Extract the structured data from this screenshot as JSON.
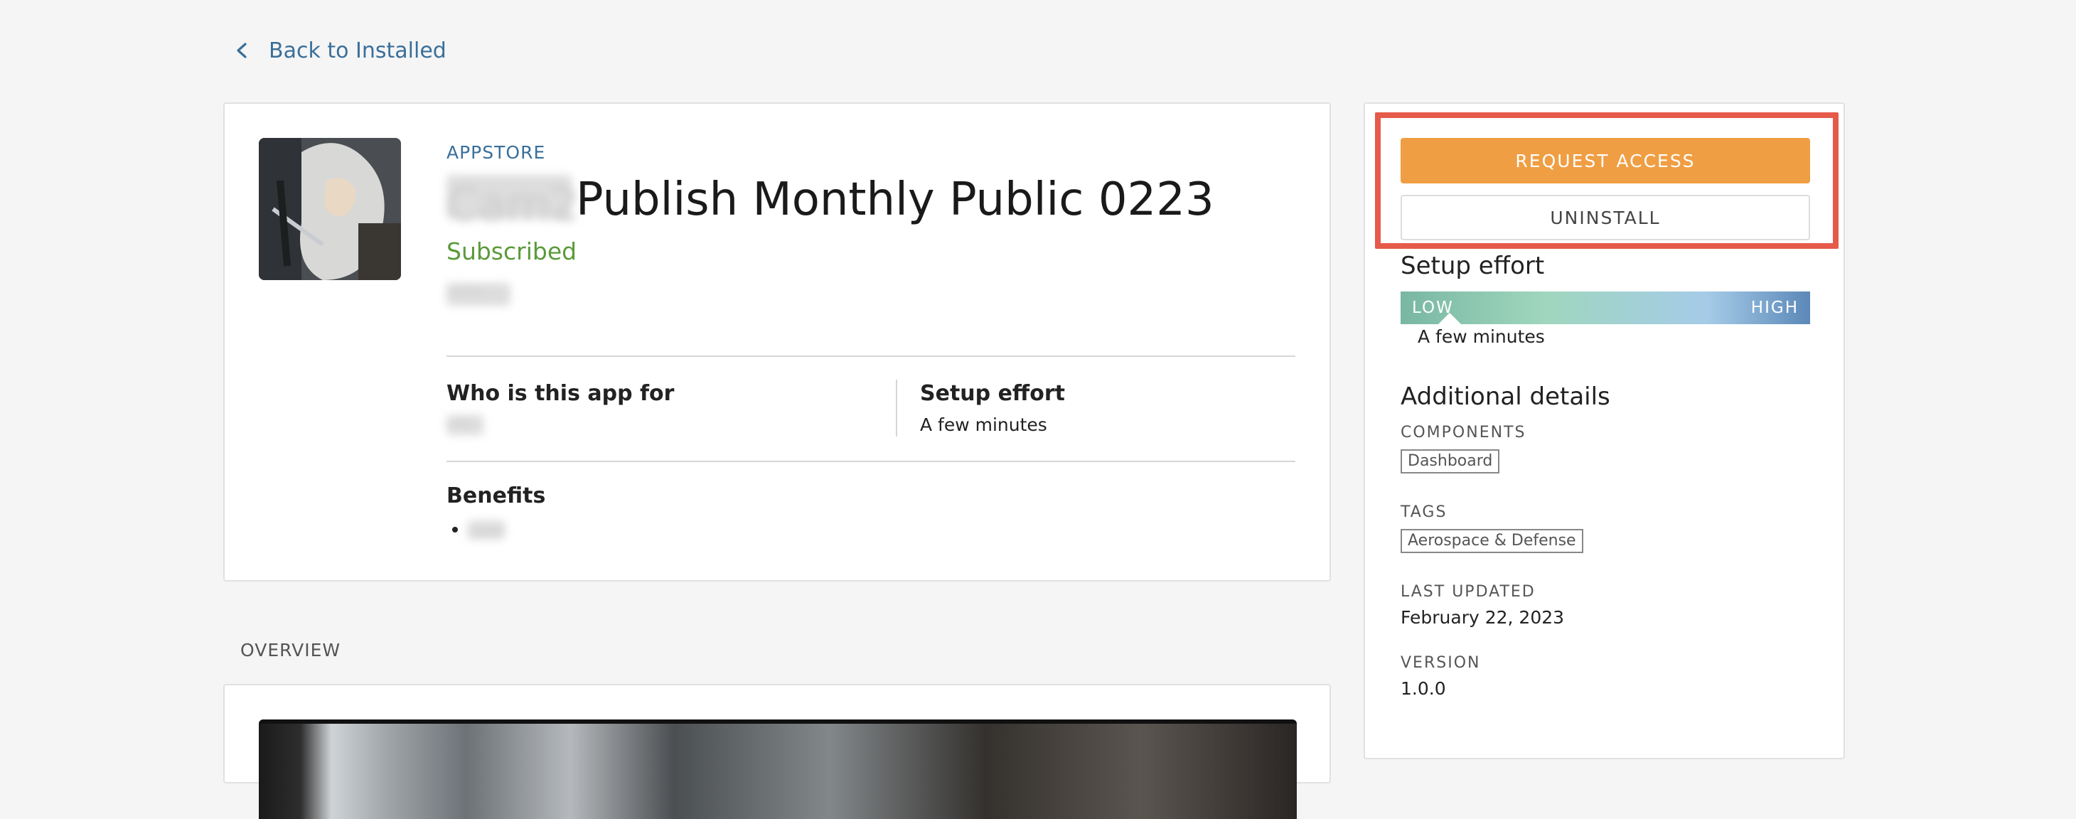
{
  "nav": {
    "back_label": "Back to Installed"
  },
  "app": {
    "store_label": "APPSTORE",
    "title_prefix_blurred": "Cam2",
    "title": "Publish Monthly Public 0223",
    "status": "Subscribed",
    "meta_blurred": "Lorem",
    "who_heading": "Who is this app for",
    "who_value_blurred": "user",
    "setup_heading": "Setup effort",
    "setup_value": "A few minutes",
    "benefits_heading": "Benefits",
    "benefits_items": [
      "user"
    ]
  },
  "overview": {
    "label": "OVERVIEW"
  },
  "sidebar": {
    "request_label": "REQUEST ACCESS",
    "uninstall_label": "UNINSTALL",
    "setup_heading": "Setup effort",
    "effort_low": "LOW",
    "effort_high": "HIGH",
    "effort_level": 0.12,
    "effort_caption": "A few minutes",
    "details_heading": "Additional details",
    "components_label": "COMPONENTS",
    "components": [
      "Dashboard"
    ],
    "tags_label": "TAGS",
    "tags": [
      "Aerospace & Defense"
    ],
    "last_updated_label": "LAST UPDATED",
    "last_updated_value": "February 22, 2023",
    "version_label": "VERSION",
    "version_value": "1.0.0"
  },
  "colors": {
    "accent_link": "#3a6f9a",
    "primary_button": "#f09e43",
    "subscribed": "#5a9a3a",
    "highlight_box": "#e65a4a"
  }
}
